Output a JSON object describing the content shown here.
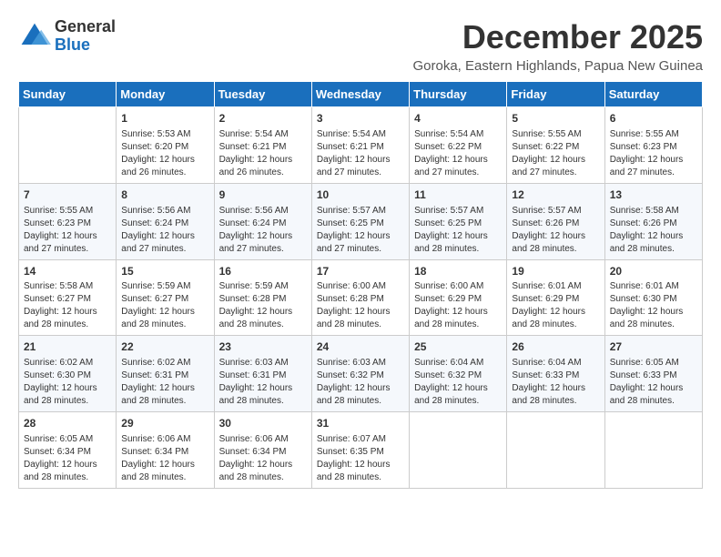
{
  "header": {
    "logo": {
      "line1": "General",
      "line2": "Blue"
    },
    "title": "December 2025",
    "subtitle": "Goroka, Eastern Highlands, Papua New Guinea"
  },
  "weekdays": [
    "Sunday",
    "Monday",
    "Tuesday",
    "Wednesday",
    "Thursday",
    "Friday",
    "Saturday"
  ],
  "weeks": [
    [
      {
        "day": "",
        "sunrise": "",
        "sunset": "",
        "daylight": ""
      },
      {
        "day": "1",
        "sunrise": "Sunrise: 5:53 AM",
        "sunset": "Sunset: 6:20 PM",
        "daylight": "Daylight: 12 hours and 26 minutes."
      },
      {
        "day": "2",
        "sunrise": "Sunrise: 5:54 AM",
        "sunset": "Sunset: 6:21 PM",
        "daylight": "Daylight: 12 hours and 26 minutes."
      },
      {
        "day": "3",
        "sunrise": "Sunrise: 5:54 AM",
        "sunset": "Sunset: 6:21 PM",
        "daylight": "Daylight: 12 hours and 27 minutes."
      },
      {
        "day": "4",
        "sunrise": "Sunrise: 5:54 AM",
        "sunset": "Sunset: 6:22 PM",
        "daylight": "Daylight: 12 hours and 27 minutes."
      },
      {
        "day": "5",
        "sunrise": "Sunrise: 5:55 AM",
        "sunset": "Sunset: 6:22 PM",
        "daylight": "Daylight: 12 hours and 27 minutes."
      },
      {
        "day": "6",
        "sunrise": "Sunrise: 5:55 AM",
        "sunset": "Sunset: 6:23 PM",
        "daylight": "Daylight: 12 hours and 27 minutes."
      }
    ],
    [
      {
        "day": "7",
        "sunrise": "Sunrise: 5:55 AM",
        "sunset": "Sunset: 6:23 PM",
        "daylight": "Daylight: 12 hours and 27 minutes."
      },
      {
        "day": "8",
        "sunrise": "Sunrise: 5:56 AM",
        "sunset": "Sunset: 6:24 PM",
        "daylight": "Daylight: 12 hours and 27 minutes."
      },
      {
        "day": "9",
        "sunrise": "Sunrise: 5:56 AM",
        "sunset": "Sunset: 6:24 PM",
        "daylight": "Daylight: 12 hours and 27 minutes."
      },
      {
        "day": "10",
        "sunrise": "Sunrise: 5:57 AM",
        "sunset": "Sunset: 6:25 PM",
        "daylight": "Daylight: 12 hours and 27 minutes."
      },
      {
        "day": "11",
        "sunrise": "Sunrise: 5:57 AM",
        "sunset": "Sunset: 6:25 PM",
        "daylight": "Daylight: 12 hours and 28 minutes."
      },
      {
        "day": "12",
        "sunrise": "Sunrise: 5:57 AM",
        "sunset": "Sunset: 6:26 PM",
        "daylight": "Daylight: 12 hours and 28 minutes."
      },
      {
        "day": "13",
        "sunrise": "Sunrise: 5:58 AM",
        "sunset": "Sunset: 6:26 PM",
        "daylight": "Daylight: 12 hours and 28 minutes."
      }
    ],
    [
      {
        "day": "14",
        "sunrise": "Sunrise: 5:58 AM",
        "sunset": "Sunset: 6:27 PM",
        "daylight": "Daylight: 12 hours and 28 minutes."
      },
      {
        "day": "15",
        "sunrise": "Sunrise: 5:59 AM",
        "sunset": "Sunset: 6:27 PM",
        "daylight": "Daylight: 12 hours and 28 minutes."
      },
      {
        "day": "16",
        "sunrise": "Sunrise: 5:59 AM",
        "sunset": "Sunset: 6:28 PM",
        "daylight": "Daylight: 12 hours and 28 minutes."
      },
      {
        "day": "17",
        "sunrise": "Sunrise: 6:00 AM",
        "sunset": "Sunset: 6:28 PM",
        "daylight": "Daylight: 12 hours and 28 minutes."
      },
      {
        "day": "18",
        "sunrise": "Sunrise: 6:00 AM",
        "sunset": "Sunset: 6:29 PM",
        "daylight": "Daylight: 12 hours and 28 minutes."
      },
      {
        "day": "19",
        "sunrise": "Sunrise: 6:01 AM",
        "sunset": "Sunset: 6:29 PM",
        "daylight": "Daylight: 12 hours and 28 minutes."
      },
      {
        "day": "20",
        "sunrise": "Sunrise: 6:01 AM",
        "sunset": "Sunset: 6:30 PM",
        "daylight": "Daylight: 12 hours and 28 minutes."
      }
    ],
    [
      {
        "day": "21",
        "sunrise": "Sunrise: 6:02 AM",
        "sunset": "Sunset: 6:30 PM",
        "daylight": "Daylight: 12 hours and 28 minutes."
      },
      {
        "day": "22",
        "sunrise": "Sunrise: 6:02 AM",
        "sunset": "Sunset: 6:31 PM",
        "daylight": "Daylight: 12 hours and 28 minutes."
      },
      {
        "day": "23",
        "sunrise": "Sunrise: 6:03 AM",
        "sunset": "Sunset: 6:31 PM",
        "daylight": "Daylight: 12 hours and 28 minutes."
      },
      {
        "day": "24",
        "sunrise": "Sunrise: 6:03 AM",
        "sunset": "Sunset: 6:32 PM",
        "daylight": "Daylight: 12 hours and 28 minutes."
      },
      {
        "day": "25",
        "sunrise": "Sunrise: 6:04 AM",
        "sunset": "Sunset: 6:32 PM",
        "daylight": "Daylight: 12 hours and 28 minutes."
      },
      {
        "day": "26",
        "sunrise": "Sunrise: 6:04 AM",
        "sunset": "Sunset: 6:33 PM",
        "daylight": "Daylight: 12 hours and 28 minutes."
      },
      {
        "day": "27",
        "sunrise": "Sunrise: 6:05 AM",
        "sunset": "Sunset: 6:33 PM",
        "daylight": "Daylight: 12 hours and 28 minutes."
      }
    ],
    [
      {
        "day": "28",
        "sunrise": "Sunrise: 6:05 AM",
        "sunset": "Sunset: 6:34 PM",
        "daylight": "Daylight: 12 hours and 28 minutes."
      },
      {
        "day": "29",
        "sunrise": "Sunrise: 6:06 AM",
        "sunset": "Sunset: 6:34 PM",
        "daylight": "Daylight: 12 hours and 28 minutes."
      },
      {
        "day": "30",
        "sunrise": "Sunrise: 6:06 AM",
        "sunset": "Sunset: 6:34 PM",
        "daylight": "Daylight: 12 hours and 28 minutes."
      },
      {
        "day": "31",
        "sunrise": "Sunrise: 6:07 AM",
        "sunset": "Sunset: 6:35 PM",
        "daylight": "Daylight: 12 hours and 28 minutes."
      },
      {
        "day": "",
        "sunrise": "",
        "sunset": "",
        "daylight": ""
      },
      {
        "day": "",
        "sunrise": "",
        "sunset": "",
        "daylight": ""
      },
      {
        "day": "",
        "sunrise": "",
        "sunset": "",
        "daylight": ""
      }
    ]
  ]
}
